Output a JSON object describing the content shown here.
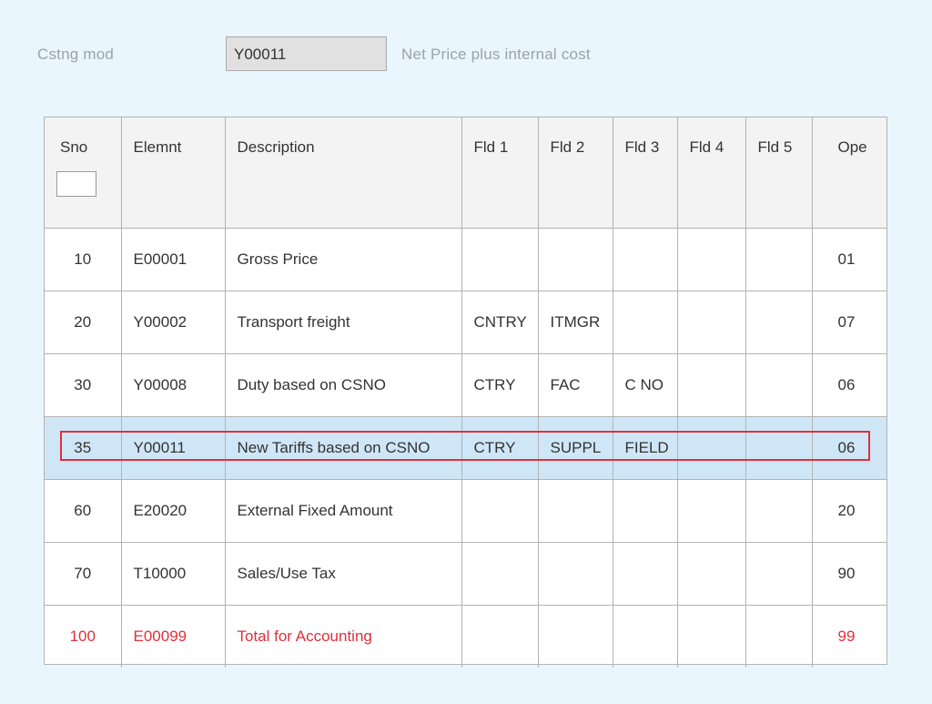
{
  "header": {
    "label": "Cstng mod",
    "value": "Y00011",
    "description": "Net Price plus internal cost"
  },
  "table": {
    "columns": [
      "Sno",
      "Elemnt",
      "Description",
      "Fld 1",
      "Fld 2",
      "Fld 3",
      "Fld 4",
      "Fld 5",
      "Ope"
    ],
    "rows": [
      [
        "10",
        "E00001",
        "Gross Price",
        "",
        "",
        "",
        "",
        "",
        "01"
      ],
      [
        "20",
        "Y00002",
        "Transport freight",
        "CNTRY",
        "ITMGR",
        "",
        "",
        "",
        "07"
      ],
      [
        "30",
        "Y00008",
        "Duty based on CSNO",
        "CTRY",
        "FAC",
        "C NO",
        "",
        "",
        "06"
      ],
      [
        "35",
        "Y00011",
        "New Tariffs based on CSNO",
        "CTRY",
        "SUPPL",
        "FIELD",
        "",
        "",
        "06"
      ],
      [
        "60",
        "E20020",
        "External Fixed Amount",
        "",
        "",
        "",
        "",
        "",
        "20"
      ],
      [
        "70",
        "T10000",
        "Sales/Use Tax",
        "",
        "",
        "",
        "",
        "",
        "90"
      ],
      [
        "100",
        "E00099",
        "Total for Accounting",
        "",
        "",
        "",
        "",
        "",
        "99"
      ]
    ],
    "selected_row": 3
  },
  "colors": {
    "background": "#eaf6fd",
    "selected_row": "#cfe6f7",
    "highlight": "#e0303a",
    "total_text": "#e0303a"
  }
}
